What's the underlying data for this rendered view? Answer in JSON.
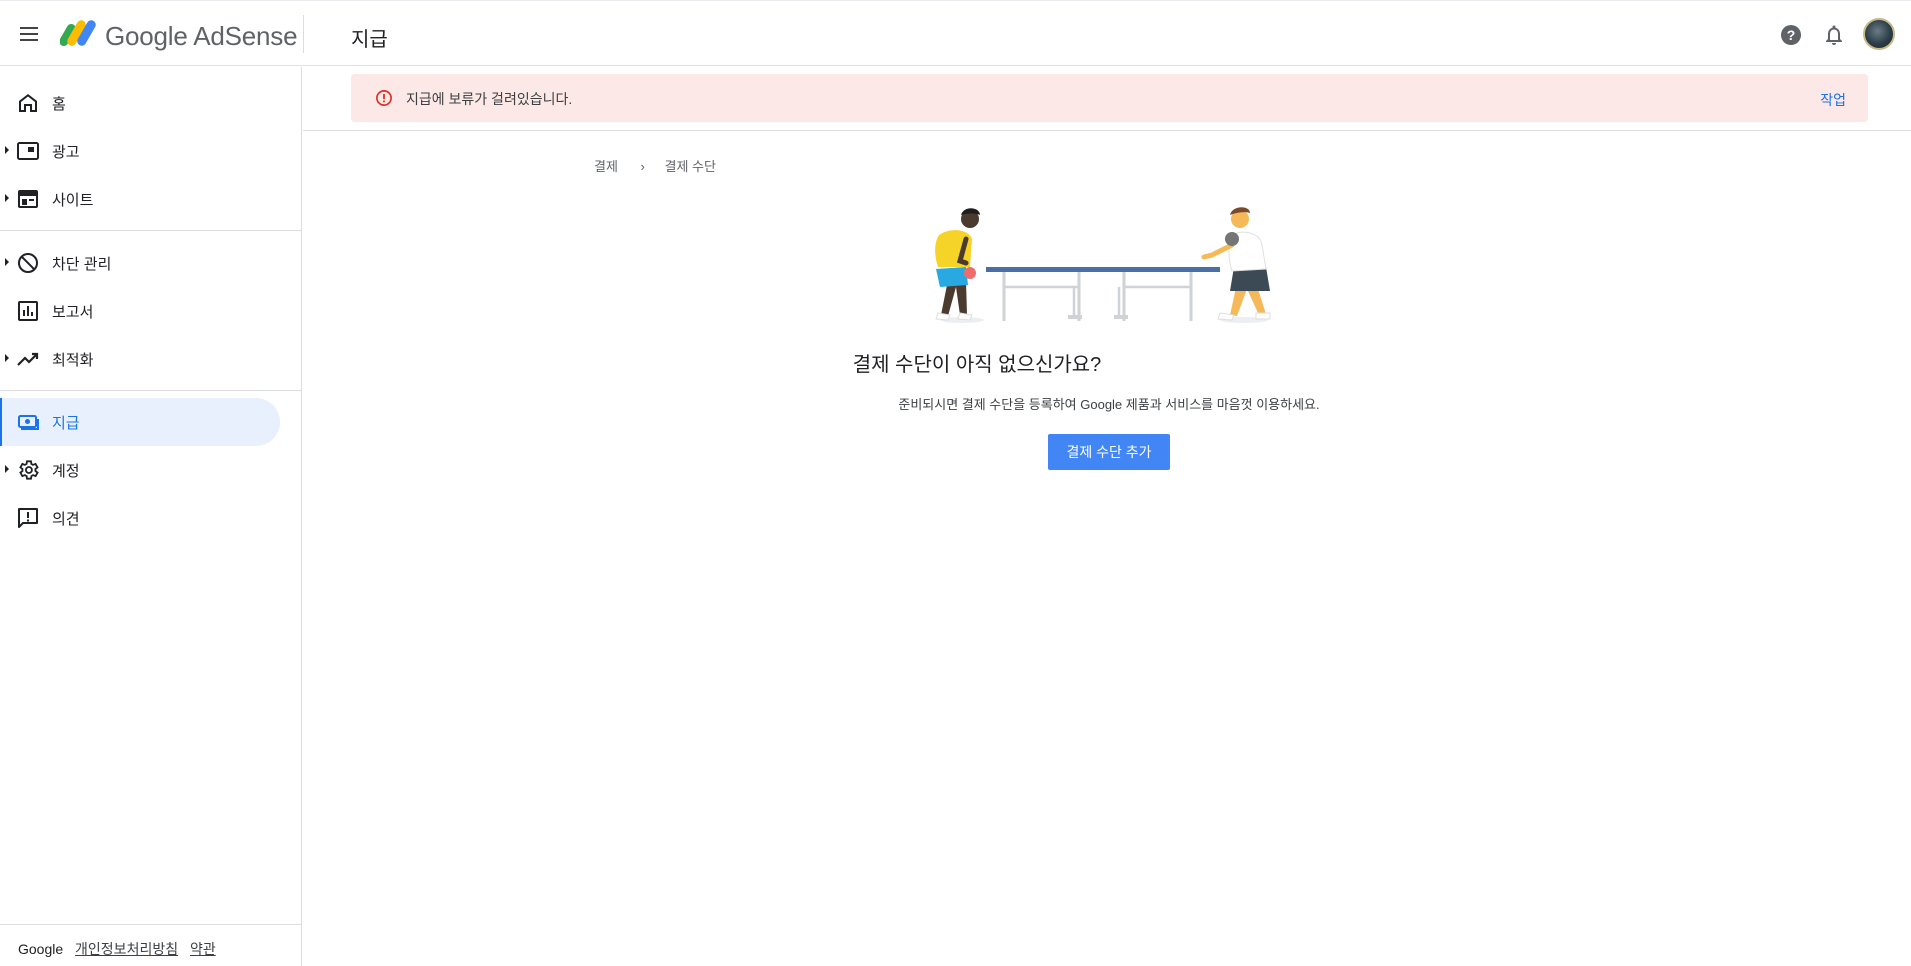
{
  "header": {
    "brand": "Google AdSense",
    "page_title": "지급",
    "icons": [
      "menu-icon",
      "help-icon",
      "notifications-icon",
      "account-avatar"
    ]
  },
  "sidebar": {
    "items": [
      {
        "label": "홈",
        "icon": "home-icon",
        "expandable": false
      },
      {
        "label": "광고",
        "icon": "ads-icon",
        "expandable": true
      },
      {
        "label": "사이트",
        "icon": "sites-icon",
        "expandable": true
      },
      {
        "label": "차단 관리",
        "icon": "block-icon",
        "expandable": true
      },
      {
        "label": "보고서",
        "icon": "reports-icon",
        "expandable": false
      },
      {
        "label": "최적화",
        "icon": "optimization-icon",
        "expandable": true
      },
      {
        "label": "지급",
        "icon": "payments-icon",
        "expandable": false,
        "active": true
      },
      {
        "label": "계정",
        "icon": "gear-icon",
        "expandable": true
      },
      {
        "label": "의견",
        "icon": "feedback-icon",
        "expandable": false
      }
    ],
    "footer": {
      "google": "Google",
      "privacy": "개인정보처리방침",
      "terms": "약관"
    }
  },
  "alert": {
    "text": "지급에 보류가 걸려있습니다.",
    "action": "작업"
  },
  "breadcrumb": {
    "items": [
      "결제",
      "결제 수단"
    ]
  },
  "empty_state": {
    "title": "결제 수단이 아직 없으신가요?",
    "description": "준비되시면 결제 수단을 등록하여 Google 제품과 서비스를 마음껏 이용하세요.",
    "button": "결제 수단 추가"
  },
  "colors": {
    "accent": "#1a73e8",
    "button": "#4285f4",
    "alert_bg": "#fce8e6",
    "alert_icon": "#d93025",
    "active_nav_bg": "#e8f0fe"
  }
}
